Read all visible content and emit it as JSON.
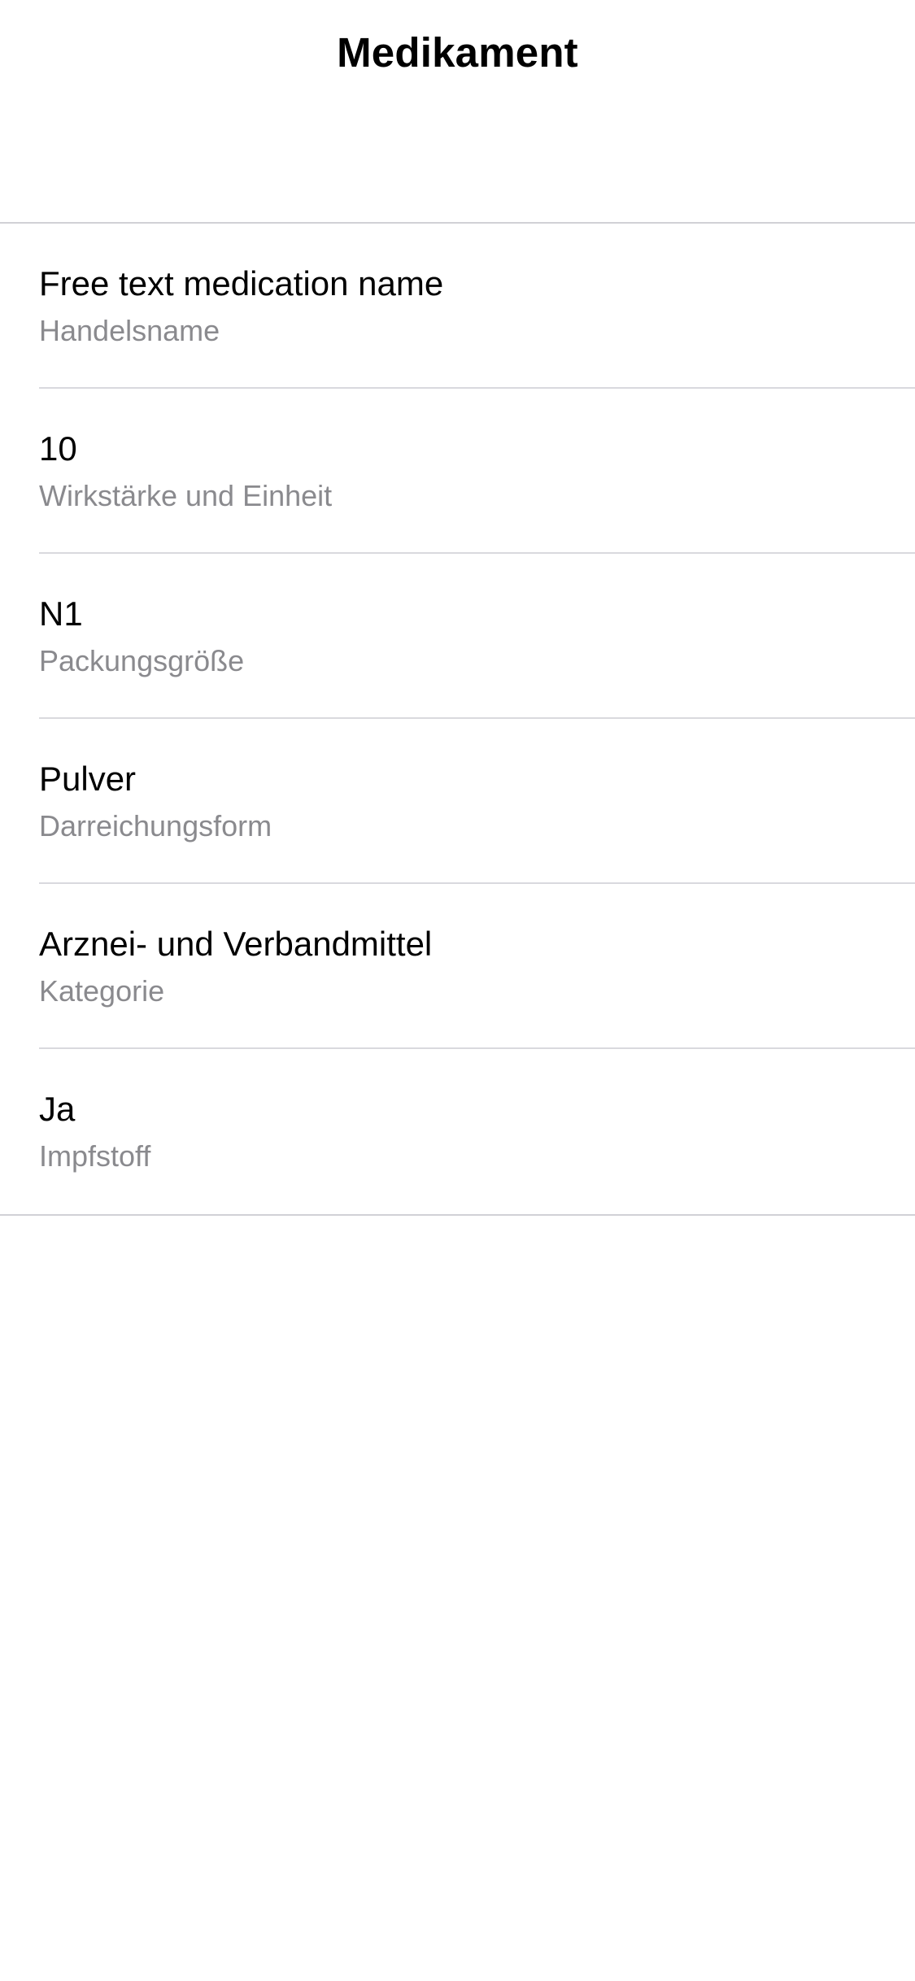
{
  "header": {
    "title": "Medikament"
  },
  "fields": [
    {
      "value": "Free text medication name",
      "label": "Handelsname"
    },
    {
      "value": "10",
      "label": "Wirkstärke und Einheit"
    },
    {
      "value": "N1",
      "label": "Packungsgröße"
    },
    {
      "value": "Pulver",
      "label": "Darreichungsform"
    },
    {
      "value": "Arznei- und Verbandmittel",
      "label": "Kategorie"
    },
    {
      "value": "Ja",
      "label": "Impfstoff"
    }
  ]
}
